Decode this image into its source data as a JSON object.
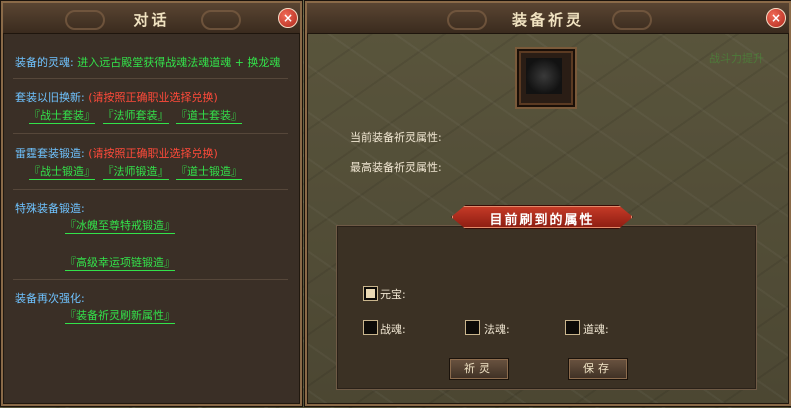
{
  "dialog": {
    "title": "对话",
    "soul_label": "装备的灵魂:",
    "soul_text": "进入远古殿堂获得战魂法魂道魂 + 换龙魂",
    "upgrade_label": "套装以旧换新:",
    "upgrade_warning": "(请按照正确职业选择兑换)",
    "upgrade_links": [
      "『战士套装』",
      "『法师套装』",
      "『道士套装』"
    ],
    "forge_label": "雷霆套装锻造:",
    "forge_warning": "(请按照正确职业选择兑换)",
    "forge_links": [
      "『战士锻造』",
      "『法师锻造』",
      "『道士锻造』"
    ],
    "special_label": "特殊装备锻造:",
    "special_link_1": "『冰魄至尊特戒锻造』",
    "special_link_2": "『高级幸运项链锻造』",
    "reforge_label": "装备再次强化:",
    "reforge_link": "『装备祈灵刷新属性』"
  },
  "pray": {
    "title": "装备祈灵",
    "current_attr_label": "当前装备祈灵属性:",
    "max_attr_label": "最高装备祈灵属性:",
    "banner": "目前刷到的属性",
    "checkboxes": {
      "yuanbao": "元宝:",
      "zhanhun": "战魂:",
      "fahun": "法魂:",
      "daohun": "道魂:"
    },
    "pray_button": "祈灵",
    "save_button": "保存",
    "bg_hint": "战斗力提升"
  },
  "colors": {
    "label_blue": "#6fc3ff",
    "link_green": "#33e24a",
    "warn_red": "#ff4a3a",
    "banner_red": "#b0281c"
  }
}
